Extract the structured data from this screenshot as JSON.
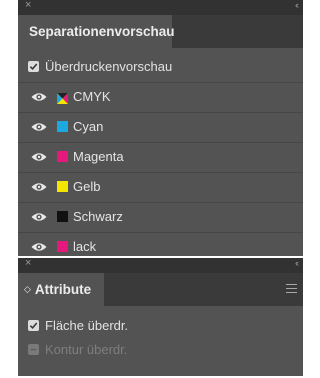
{
  "panel1": {
    "close_glyph": "×",
    "collapse_glyph": "‹‹",
    "tab_label": "Separationenvorschau",
    "overprint_label": "Überdruckenvorschau",
    "overprint_checked": true,
    "separations": [
      {
        "name": "CMYK",
        "color": "cmyk",
        "visible": true
      },
      {
        "name": "Cyan",
        "color": "#1ba9e0",
        "visible": true
      },
      {
        "name": "Magenta",
        "color": "#e5197b",
        "visible": true
      },
      {
        "name": "Gelb",
        "color": "#f3e500",
        "visible": true
      },
      {
        "name": "Schwarz",
        "color": "#111111",
        "visible": true
      },
      {
        "name": "lack",
        "color": "#e5197b",
        "visible": true
      }
    ]
  },
  "panel2": {
    "close_glyph": "×",
    "collapse_glyph": "‹‹",
    "tab_label": "Attribute",
    "tab_arrow": "◇",
    "fill_overprint_label": "Fläche überdr.",
    "fill_overprint_checked": true,
    "stroke_overprint_label": "Kontur überdr.",
    "stroke_overprint_enabled": false
  }
}
